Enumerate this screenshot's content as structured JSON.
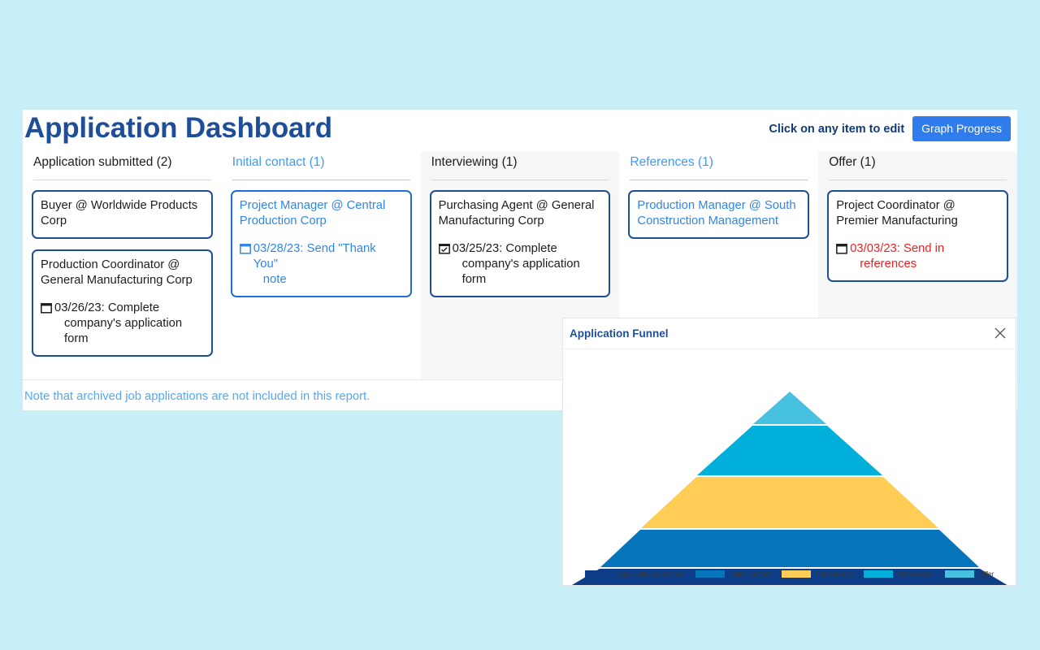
{
  "page": {
    "background_color": "#c8eef8"
  },
  "header": {
    "title": "Application Dashboard",
    "hint": "Click on any item to edit",
    "graph_button": "Graph Progress",
    "accent_color": "#1f4e99",
    "button_color": "#2f7ded"
  },
  "columns": [
    {
      "header": "Application submitted (2)",
      "highlighted": false,
      "shaded": false,
      "cards": [
        {
          "title": "Buyer @ Worldwide Products Corp",
          "style": "dark",
          "task": null
        },
        {
          "title": "Production Coordinator @ General Manufacturing Corp",
          "style": "dark",
          "task": {
            "icon": "calendar-icon",
            "checked": false,
            "line1": "03/26/23: Complete",
            "line2": "company's application form",
            "state": "normal"
          }
        }
      ]
    },
    {
      "header": "Initial contact (1)",
      "highlighted": true,
      "shaded": false,
      "cards": [
        {
          "title": "Project Manager @ Central Production Corp",
          "style": "blue",
          "task": {
            "icon": "calendar-icon",
            "checked": false,
            "line1": "03/28/23: Send \"Thank You\"",
            "line2": "note",
            "state": "blue"
          }
        }
      ]
    },
    {
      "header": "Interviewing (1)",
      "highlighted": false,
      "shaded": true,
      "cards": [
        {
          "title": "Purchasing Agent @ General Manufacturing Corp",
          "style": "dark",
          "task": {
            "icon": "calendar-check-icon",
            "checked": true,
            "line1": "03/25/23: Complete",
            "line2": "company's application form",
            "state": "normal"
          }
        }
      ]
    },
    {
      "header": "References (1)",
      "highlighted": true,
      "shaded": false,
      "cards": [
        {
          "title": "Production Manager @ South Construction Management",
          "style": "blue-border-dark",
          "task": null
        }
      ]
    },
    {
      "header": "Offer (1)",
      "highlighted": false,
      "shaded": true,
      "cards": [
        {
          "title": "Project Coordinator @ Premier Manufacturing",
          "style": "dark",
          "task": {
            "icon": "calendar-icon",
            "checked": false,
            "line1": "03/03/23: Send in",
            "line2": "references",
            "state": "overdue"
          }
        }
      ]
    }
  ],
  "note": "Note that archived job applications are not included in this report.",
  "funnel": {
    "title": "Application Funnel",
    "close_icon": "close-icon"
  },
  "chart_data": {
    "type": "funnel",
    "title": "Application Funnel",
    "orientation": "pyramid-upright",
    "legend_position": "bottom",
    "categories": [
      "Application submitted",
      "Initial contact",
      "Interviewing",
      "References",
      "Offer"
    ],
    "values": [
      2,
      1,
      1,
      1,
      1
    ],
    "colors": [
      "#0c3d86",
      "#0675bb",
      "#ffcd56",
      "#00b0da",
      "#46c2e0"
    ],
    "band_fractions": [
      0.26,
      0.21,
      0.21,
      0.2,
      0.12
    ],
    "xlabel": "",
    "ylabel": "",
    "grid": false
  }
}
